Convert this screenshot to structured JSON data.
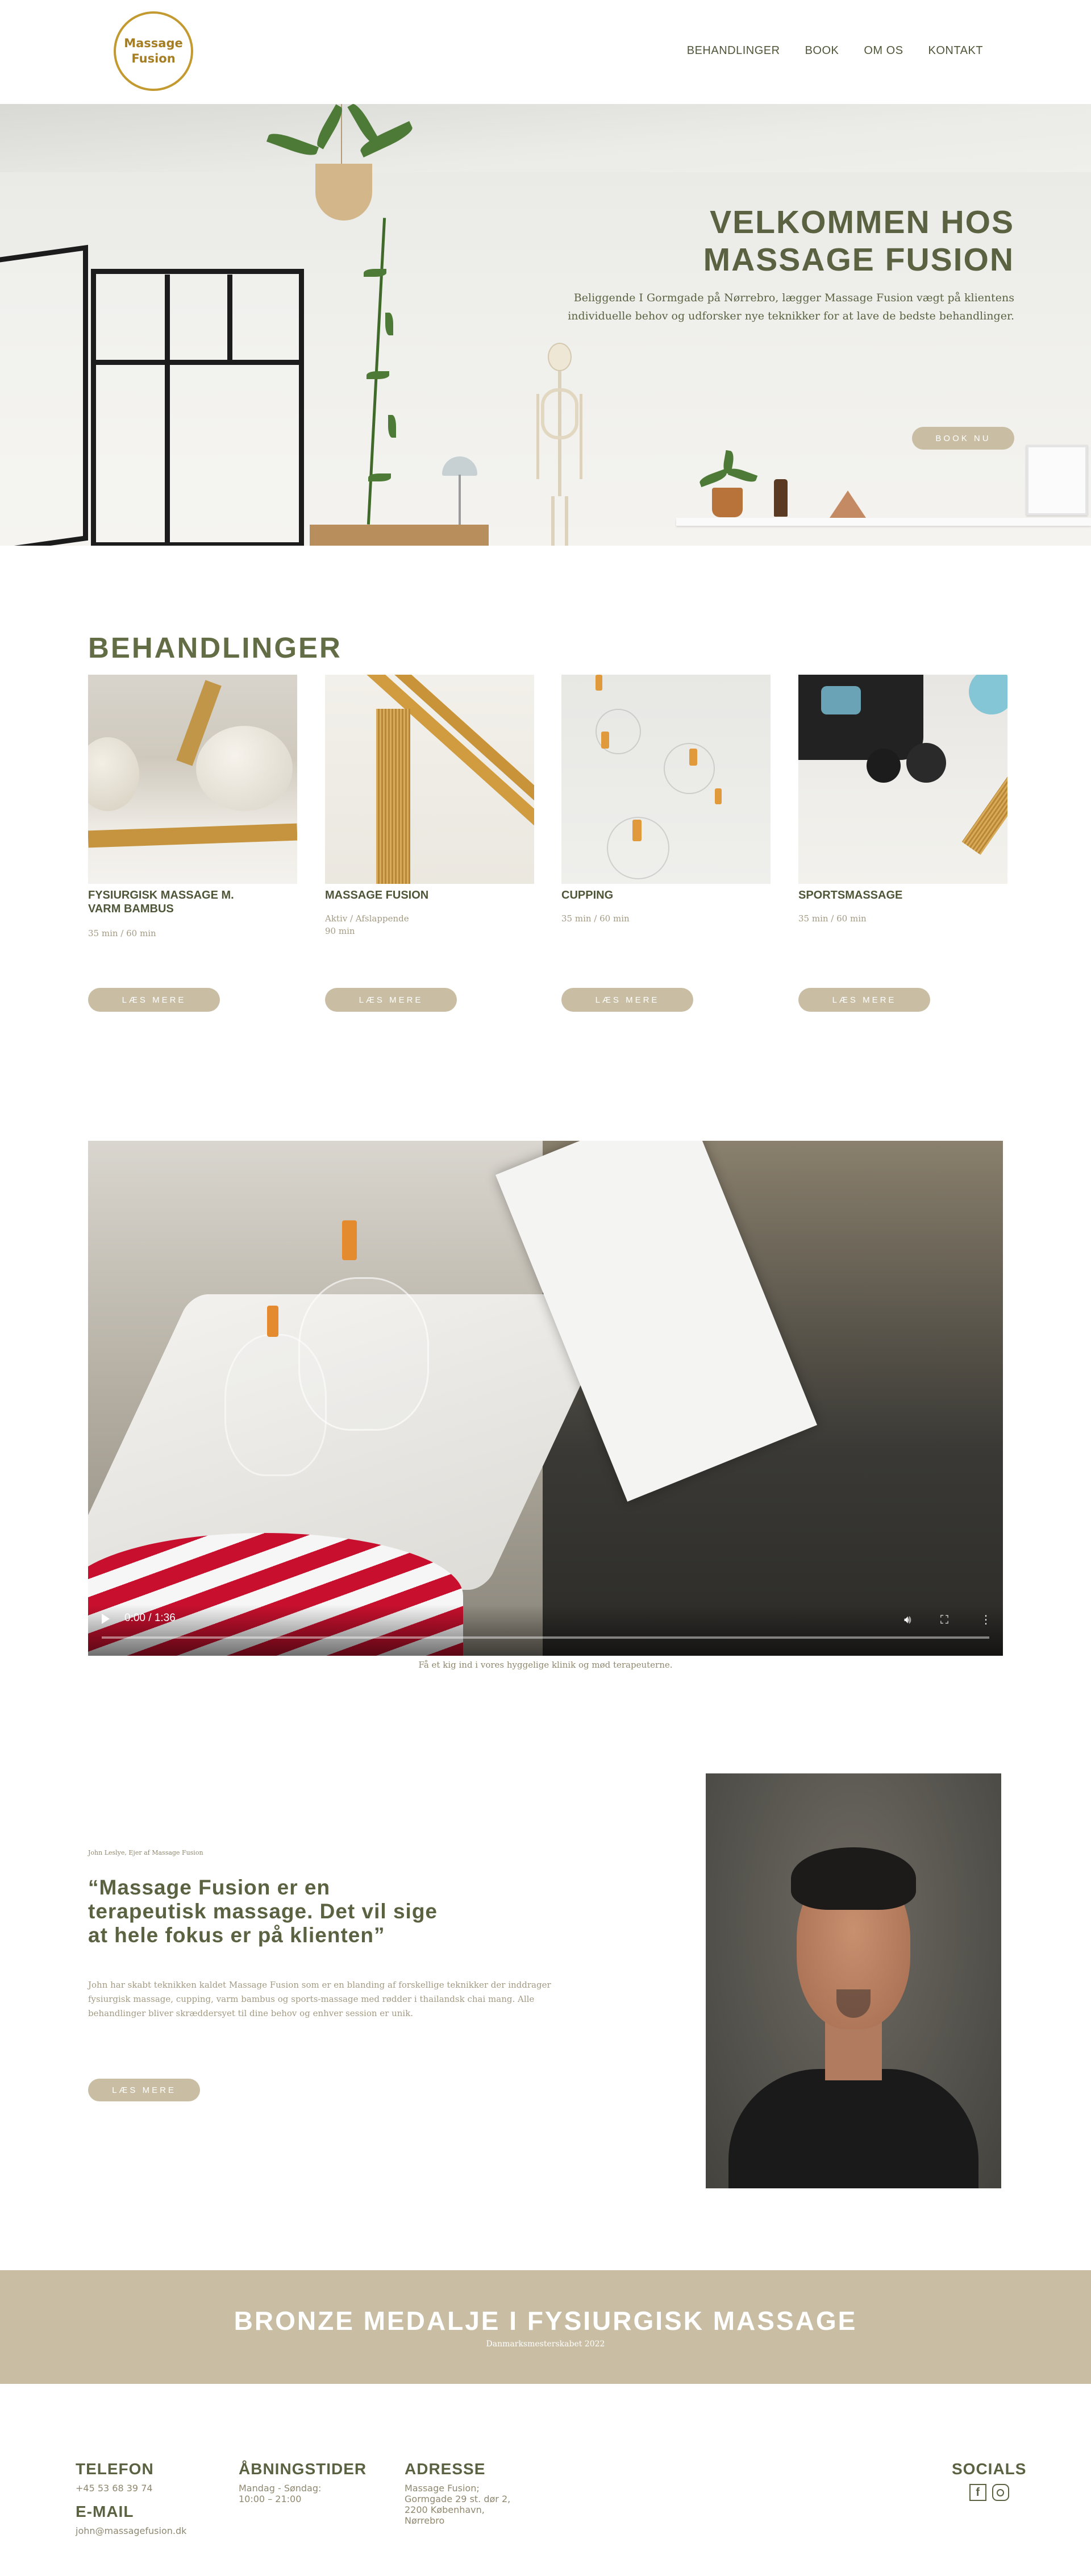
{
  "header": {
    "logo_line1": "Massage",
    "logo_line2": "Fusion",
    "nav": [
      "BEHANDLINGER",
      "BOOK",
      "OM OS",
      "KONTAKT"
    ]
  },
  "hero": {
    "title_line1": "VELKOMMEN HOS",
    "title_line2": "MASSAGE FUSION",
    "text": "Beliggende I Gormgade på Nørrebro, lægger Massage Fusion vægt på klientens individuelle behov og udforsker nye teknikker for at lave de bedste behandlinger.",
    "button": "BOOK NU"
  },
  "treatments": {
    "title": "BEHANDLINGER",
    "items": [
      {
        "name": "FYSIURGISK MASSAGE M. VARM BAMBUS",
        "info": "35 min / 60 min",
        "button": "LÆS MERE"
      },
      {
        "name": "MASSAGE FUSION",
        "info": "Aktiv / Afslappende\n90 min",
        "button": "LÆS MERE"
      },
      {
        "name": "CUPPING",
        "info": "35 min / 60 min",
        "button": "LÆS MERE"
      },
      {
        "name": "SPORTSMASSAGE",
        "info": "35 min / 60 min",
        "button": "LÆS MERE"
      }
    ]
  },
  "video": {
    "time": "0:00 / 1:36",
    "caption": "Få et kig ind i vores hyggelige klinik og mød terapeuterne."
  },
  "testimonial": {
    "small": "John Leslye, Ejer af Massage Fusion",
    "quote": "“Massage Fusion er en terapeutisk massage. Det vil sige at hele fokus er på klienten”",
    "body": "John har skabt teknikken kaldet Massage Fusion som er en blanding af forskellige teknikker der inddrager fysiurgisk massage, cupping, varm bambus og sports-massage med rødder i thailandsk chai mang. Alle behandlinger bliver skræddersyet til dine behov og enhver session er unik.",
    "button": "LÆS MERE"
  },
  "banner": {
    "title": "BRONZE MEDALJE I FYSIURGISK MASSAGE",
    "subtitle": "Danmarksmesterskabet 2022"
  },
  "footer": {
    "telefon_label": "TELEFON",
    "telefon_value": "+45 53 68 39 74",
    "email_label": "E-MAIL",
    "email_value": "john@massagefusion.dk",
    "hours_label": "ÅBNINGSTIDER",
    "hours_line1": "Mandag - Søndag:",
    "hours_line2": "10:00 – 21:00",
    "address_label": "ADRESSE",
    "address_line1": "Massage Fusion;",
    "address_line2": "Gormgade 29 st. dør 2,",
    "address_line3": "2200 København,",
    "address_line4": "Nørrebro",
    "socials_label": "SOCIALS",
    "icons": [
      "facebook-icon",
      "instagram-icon"
    ]
  },
  "colors": {
    "accent": "#c9bea3",
    "olive": "#5a6242",
    "gold": "#c39a2f"
  }
}
